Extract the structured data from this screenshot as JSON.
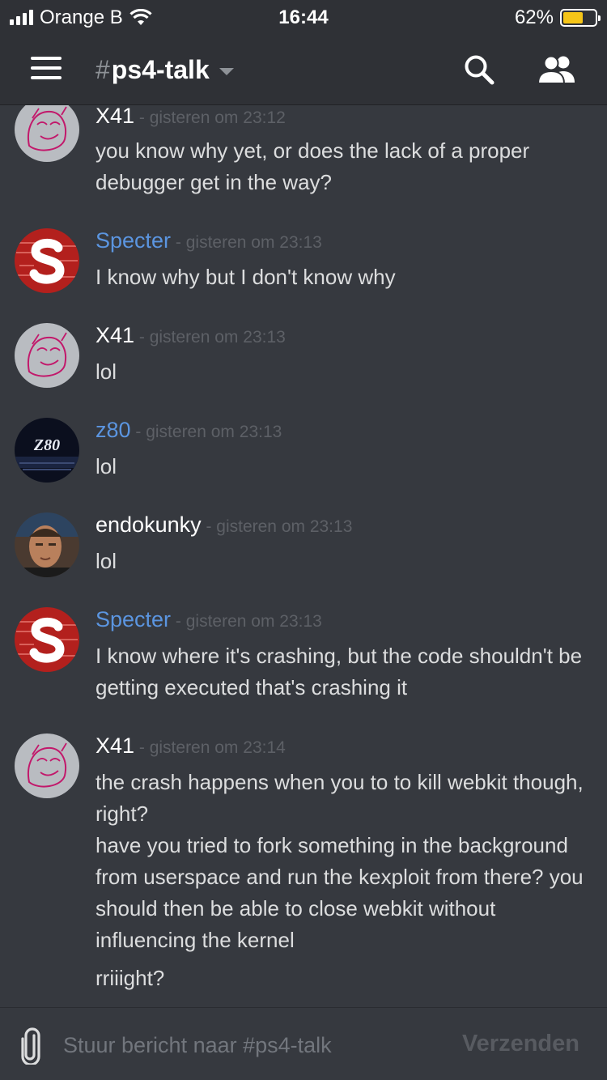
{
  "status": {
    "carrier": "Orange B",
    "time": "16:44",
    "battery": "62%",
    "battery_level": 0.62
  },
  "header": {
    "hash": "#",
    "channel": "ps4-talk"
  },
  "messages": [
    {
      "author": "X41",
      "timestamp": " - gisteren om 23:12",
      "lines": [
        "you know why yet, or does the lack of a proper debugger get in the way?"
      ]
    },
    {
      "author": "Specter",
      "timestamp": " - gisteren om 23:13",
      "lines": [
        "I know why but I don't know why"
      ]
    },
    {
      "author": "X41",
      "timestamp": " - gisteren om 23:13",
      "lines": [
        "lol"
      ]
    },
    {
      "author": "z80",
      "timestamp": " - gisteren om 23:13",
      "lines": [
        "lol"
      ]
    },
    {
      "author": "endokunky",
      "timestamp": " - gisteren om 23:13",
      "lines": [
        "lol"
      ]
    },
    {
      "author": "Specter",
      "timestamp": " - gisteren om 23:13",
      "lines": [
        "I know where it's crashing, but the code shouldn't be getting executed that's crashing it"
      ]
    },
    {
      "author": "X41",
      "timestamp": " - gisteren om 23:14",
      "lines": [
        "the crash happens when you to to kill webkit though, right?",
        "have you tried to fork something in the background from userspace and run the kexploit from there? you should then be able to close webkit without influencing the kernel",
        "rriiight?"
      ]
    }
  ],
  "avatars": {
    "z80_text": "Z80"
  },
  "composer": {
    "placeholder": "Stuur bericht naar #ps4-talk",
    "send_label": "Verzenden"
  },
  "colors": {
    "background": "#36393f",
    "header": "#2f3136",
    "link_blue": "#5b95e0",
    "timestamp": "#5d6066"
  },
  "icons": [
    "hamburger-icon",
    "search-icon",
    "members-icon",
    "paperclip-icon"
  ]
}
